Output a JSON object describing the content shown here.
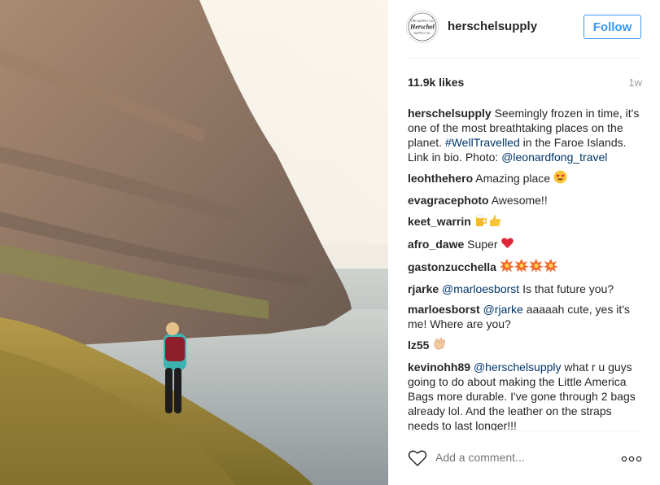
{
  "post": {
    "username": "herschelsupply",
    "follow_label": "Follow",
    "likes": "11.9k likes",
    "time": "1w",
    "avatar_text": [
      "THE SUPPLY CO.",
      "Herschel",
      "SUPPLY CO."
    ]
  },
  "caption": {
    "user": "herschelsupply",
    "text1": " Seemingly frozen in time, it's one of the most breathtaking places on the planet. ",
    "hashtag": "#WellTravelled",
    "text2": " in the Faroe Islands. Link in bio. Photo: ",
    "mention": "@leonardfong_travel"
  },
  "comments": [
    {
      "user": "leohthehero",
      "text": "Amazing place",
      "emoji": "heart-eyes-icon"
    },
    {
      "user": "evagracephoto",
      "text": "Awesome!!"
    },
    {
      "user": "keet_warrin",
      "text": "",
      "emoji": "beers-thumbs-icon"
    },
    {
      "user": "afro_dawe",
      "text": "Super",
      "emoji": "red-heart-icon"
    },
    {
      "user": "gastonzucchella",
      "text": "",
      "emoji": "collision-icons"
    },
    {
      "user": "rjarke",
      "mention": "@marloesborst",
      "text": " Is that future you?"
    },
    {
      "user": "marloesborst",
      "mention": "@rjarke",
      "text": " aaaaah cute, yes it's me! Where are you?"
    },
    {
      "user": "lz55",
      "text": "",
      "emoji": "clapping-hands-icon"
    },
    {
      "user": "kevinohh89",
      "mention": "@herschelsupply",
      "text": " what r u guys going to do about making the Little America Bags more durable. I've gone through 2 bags already lol. And the leather on the straps needs to last longer!!!"
    }
  ],
  "add_comment": {
    "placeholder": "Add a comment..."
  },
  "colors": {
    "accent": "#3897f0",
    "link": "#003569",
    "muted": "#999999"
  }
}
